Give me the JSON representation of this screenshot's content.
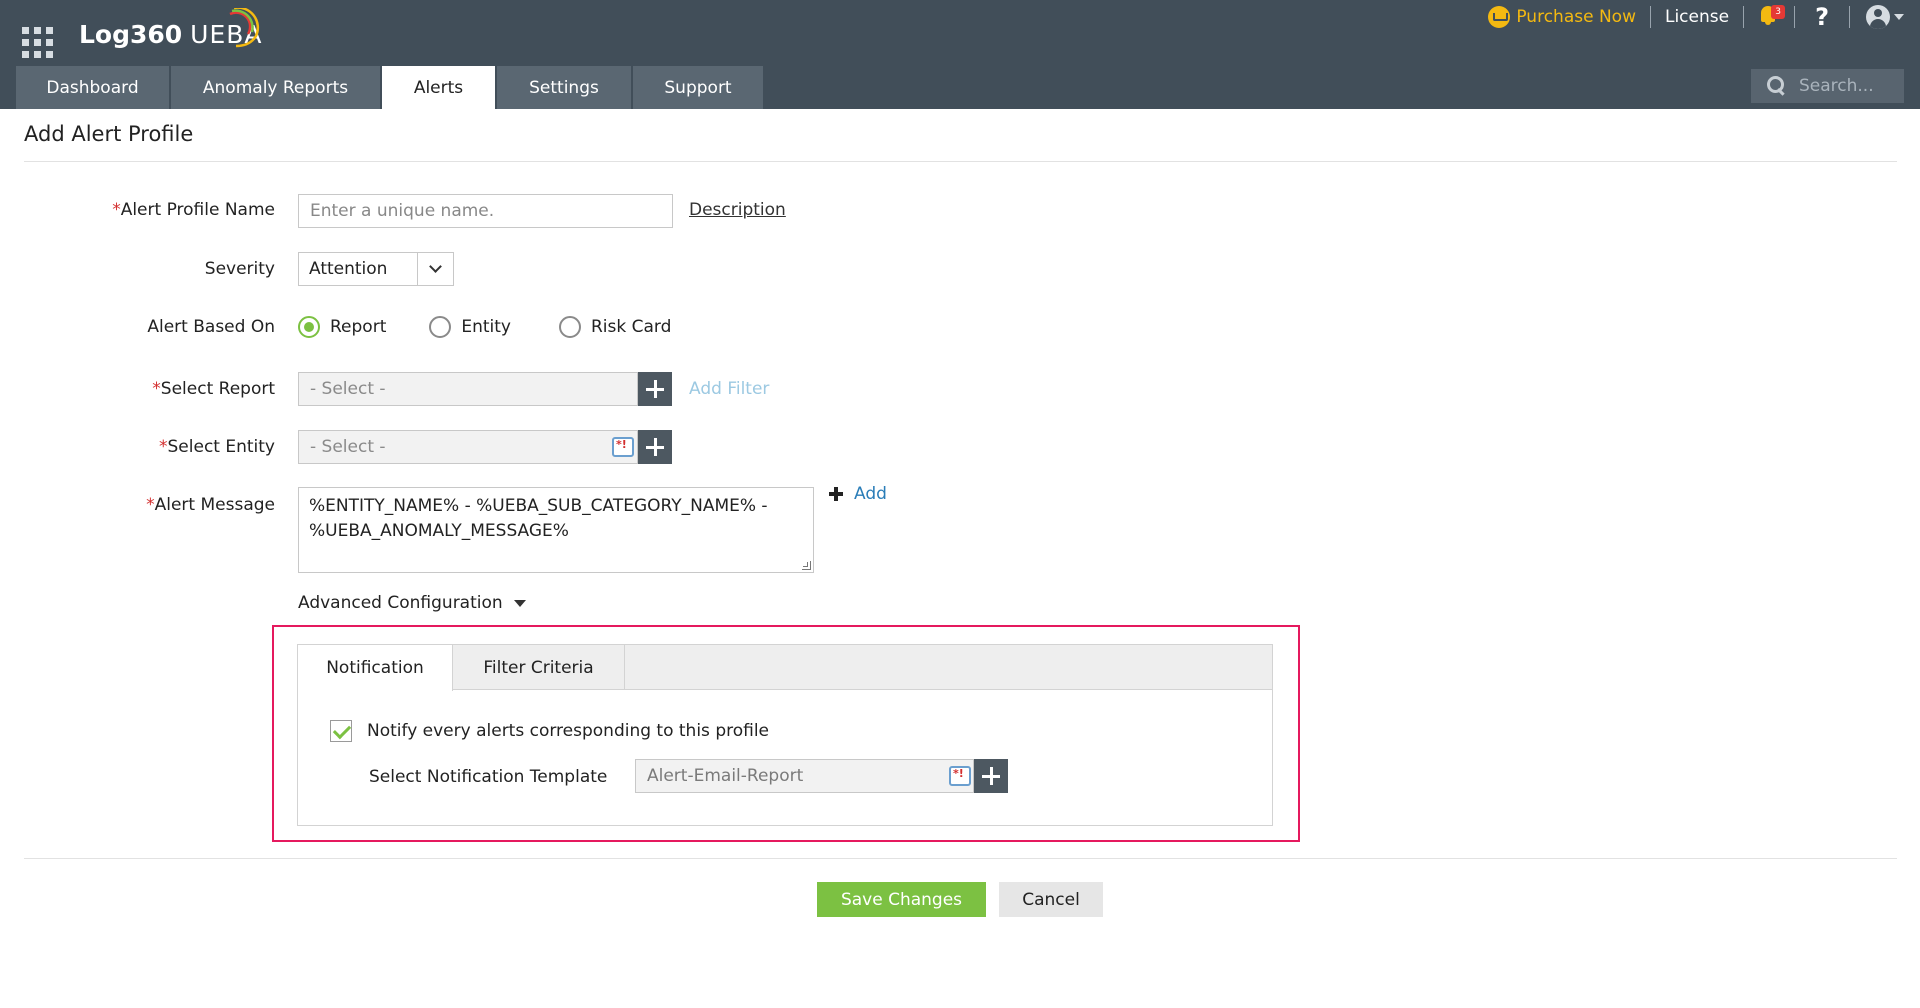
{
  "header": {
    "logo_brand": "Log360",
    "logo_product": "UEBA",
    "purchase_label": "Purchase Now",
    "license_label": "License",
    "notification_count": "3",
    "help_label": "?",
    "icons": [
      "apps-grid-icon",
      "cart-icon",
      "bell-icon",
      "help-icon",
      "user-icon",
      "search-icon"
    ],
    "colors": {
      "topbar": "#414e59",
      "accent_yellow": "#f4b911",
      "badge_red": "#e53935"
    }
  },
  "nav": {
    "tabs": [
      {
        "label": "Dashboard",
        "active": false
      },
      {
        "label": "Anomaly Reports",
        "active": false
      },
      {
        "label": "Alerts",
        "active": true
      },
      {
        "label": "Settings",
        "active": false
      },
      {
        "label": "Support",
        "active": false
      }
    ],
    "search_placeholder": "Search..."
  },
  "page": {
    "title": "Add Alert Profile"
  },
  "form": {
    "required_mark": "*",
    "profile_name": {
      "label": "Alert Profile Name",
      "placeholder": "Enter a unique name.",
      "description_link": "Description"
    },
    "severity": {
      "label": "Severity",
      "value": "Attention"
    },
    "alert_based_on": {
      "label": "Alert Based On",
      "options": [
        {
          "label": "Report",
          "checked": true
        },
        {
          "label": "Entity",
          "checked": false
        },
        {
          "label": "Risk Card",
          "checked": false
        }
      ]
    },
    "select_report": {
      "label": "Select Report",
      "placeholder": "- Select -",
      "add_filter_link": "Add Filter"
    },
    "select_entity": {
      "label": "Select Entity",
      "placeholder": "- Select -"
    },
    "alert_message": {
      "label": "Alert Message",
      "value": "%ENTITY_NAME% - %UEBA_SUB_CATEGORY_NAME% - %UEBA_ANOMALY_MESSAGE%",
      "add_link": "Add"
    },
    "advanced_config_label": "Advanced Configuration"
  },
  "advanced": {
    "tabs": [
      {
        "label": "Notification",
        "active": true
      },
      {
        "label": "Filter Criteria",
        "active": false
      }
    ],
    "notify_checkbox": {
      "label": "Notify every alerts corresponding to this profile",
      "checked": true
    },
    "template": {
      "label": "Select Notification Template",
      "value": "Alert-Email-Report"
    },
    "highlight_color": "#e5195e"
  },
  "actions": {
    "save_label": "Save Changes",
    "cancel_label": "Cancel",
    "save_color": "#7cc142"
  }
}
